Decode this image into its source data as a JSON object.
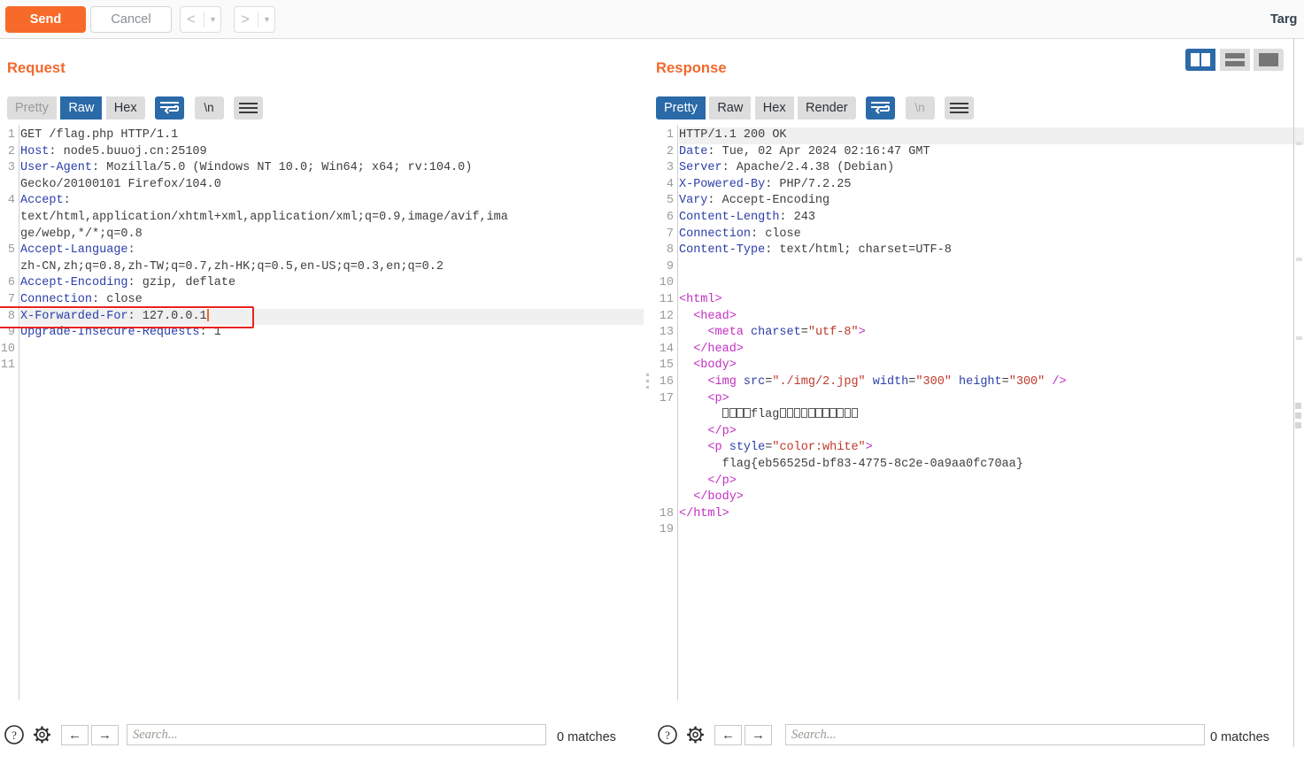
{
  "toolbar": {
    "send_label": "Send",
    "cancel_label": "Cancel",
    "prev_glyph": "<",
    "next_glyph": ">",
    "caret_glyph": "▼",
    "target_label": "Targ",
    "accent_color": "#f76a29"
  },
  "layout_buttons": {
    "side_by_side": "side-by-side",
    "stacked": "stacked",
    "single": "single-pane",
    "selected": "side-by-side"
  },
  "request": {
    "title": "Request",
    "tabs": [
      {
        "label": "Pretty",
        "state": "disabled"
      },
      {
        "label": "Raw",
        "state": "selected"
      },
      {
        "label": "Hex",
        "state": "normal"
      }
    ],
    "wrap_button": {
      "icon": "word-wrap-icon",
      "state": "selected"
    },
    "newline_button": {
      "label": "\\n",
      "state": "normal"
    },
    "menu_button": {
      "icon": "hamburger-menu-icon"
    },
    "line_numbers": [
      "1",
      "2",
      "3",
      "",
      "4",
      "",
      "",
      "5",
      "",
      "6",
      "7",
      "8",
      "9",
      "10",
      "11"
    ],
    "lines": [
      {
        "n": "1",
        "segments": [
          {
            "t": "GET /flag.php HTTP/1.1",
            "c": "txt"
          }
        ]
      },
      {
        "n": "2",
        "segments": [
          {
            "t": "Host",
            "c": "hdr"
          },
          {
            "t": ": node5.buuoj.cn:25109",
            "c": "txt"
          }
        ]
      },
      {
        "n": "3",
        "segments": [
          {
            "t": "User-Agent",
            "c": "hdr"
          },
          {
            "t": ": Mozilla/5.0 (Windows NT 10.0; Win64; x64; rv:104.0)",
            "c": "txt"
          }
        ]
      },
      {
        "n": "",
        "segments": [
          {
            "t": "Gecko/20100101 Firefox/104.0",
            "c": "txt"
          }
        ]
      },
      {
        "n": "4",
        "segments": [
          {
            "t": "Accept",
            "c": "hdr"
          },
          {
            "t": ":",
            "c": "txt"
          }
        ]
      },
      {
        "n": "",
        "segments": [
          {
            "t": "text/html,application/xhtml+xml,application/xml;q=0.9,image/avif,ima",
            "c": "txt"
          }
        ]
      },
      {
        "n": "",
        "segments": [
          {
            "t": "ge/webp,*/*;q=0.8",
            "c": "txt"
          }
        ]
      },
      {
        "n": "5",
        "segments": [
          {
            "t": "Accept-Language",
            "c": "hdr"
          },
          {
            "t": ":",
            "c": "txt"
          }
        ]
      },
      {
        "n": "",
        "segments": [
          {
            "t": "zh-CN,zh;q=0.8,zh-TW;q=0.7,zh-HK;q=0.5,en-US;q=0.3,en;q=0.2",
            "c": "txt"
          }
        ]
      },
      {
        "n": "6",
        "segments": [
          {
            "t": "Accept-Encoding",
            "c": "hdr"
          },
          {
            "t": ": gzip, deflate",
            "c": "txt"
          }
        ]
      },
      {
        "n": "7",
        "segments": [
          {
            "t": "Connection",
            "c": "hdr"
          },
          {
            "t": ": close",
            "c": "txt"
          }
        ]
      },
      {
        "n": "8",
        "highlight": true,
        "caret": true,
        "segments": [
          {
            "t": "X-Forwarded-For",
            "c": "hdr"
          },
          {
            "t": ": 127.0.0.1",
            "c": "txt"
          }
        ]
      },
      {
        "n": "9",
        "segments": [
          {
            "t": "Upgrade-Insecure-Requests",
            "c": "hdr"
          },
          {
            "t": ": 1",
            "c": "txt"
          }
        ]
      },
      {
        "n": "10",
        "segments": []
      },
      {
        "n": "11",
        "segments": []
      }
    ],
    "annotation": {
      "shape": "rectangle",
      "color": "#e8231f",
      "targets_line": "8"
    },
    "search": {
      "help_icon": "help-circle-icon",
      "settings_icon": "gear-icon",
      "prev_icon": "arrow-left-icon",
      "next_icon": "arrow-right-icon",
      "placeholder": "Search...",
      "value": "",
      "matches": "0 matches"
    }
  },
  "response": {
    "title": "Response",
    "tabs": [
      {
        "label": "Pretty",
        "state": "selected"
      },
      {
        "label": "Raw",
        "state": "normal"
      },
      {
        "label": "Hex",
        "state": "normal"
      },
      {
        "label": "Render",
        "state": "normal"
      }
    ],
    "wrap_button": {
      "icon": "word-wrap-icon",
      "state": "selected"
    },
    "newline_button": {
      "label": "\\n",
      "state": "disabled"
    },
    "menu_button": {
      "icon": "hamburger-menu-icon"
    },
    "lines": [
      {
        "n": "1",
        "highlight": true,
        "segments": [
          {
            "t": "HTTP/1.1 200 OK",
            "c": "txt"
          }
        ]
      },
      {
        "n": "2",
        "segments": [
          {
            "t": "Date",
            "c": "hdr"
          },
          {
            "t": ": Tue, 02 Apr 2024 02:16:47 GMT",
            "c": "txt"
          }
        ]
      },
      {
        "n": "3",
        "segments": [
          {
            "t": "Server",
            "c": "hdr"
          },
          {
            "t": ": Apache/2.4.38 (Debian)",
            "c": "txt"
          }
        ]
      },
      {
        "n": "4",
        "segments": [
          {
            "t": "X-Powered-By",
            "c": "hdr"
          },
          {
            "t": ": PHP/7.2.25",
            "c": "txt"
          }
        ]
      },
      {
        "n": "5",
        "segments": [
          {
            "t": "Vary",
            "c": "hdr"
          },
          {
            "t": ": Accept-Encoding",
            "c": "txt"
          }
        ]
      },
      {
        "n": "6",
        "segments": [
          {
            "t": "Content-Length",
            "c": "hdr"
          },
          {
            "t": ": 243",
            "c": "txt"
          }
        ]
      },
      {
        "n": "7",
        "segments": [
          {
            "t": "Connection",
            "c": "hdr"
          },
          {
            "t": ": close",
            "c": "txt"
          }
        ]
      },
      {
        "n": "8",
        "segments": [
          {
            "t": "Content-Type",
            "c": "hdr"
          },
          {
            "t": ": text/html; charset=UTF-8",
            "c": "txt"
          }
        ]
      },
      {
        "n": "9",
        "segments": []
      },
      {
        "n": "10",
        "segments": []
      },
      {
        "n": "11",
        "segments": [
          {
            "t": "<html>",
            "c": "tag"
          }
        ]
      },
      {
        "n": "12",
        "segments": [
          {
            "t": "  ",
            "c": "txt"
          },
          {
            "t": "<head>",
            "c": "tag"
          }
        ]
      },
      {
        "n": "13",
        "segments": [
          {
            "t": "    ",
            "c": "txt"
          },
          {
            "t": "<meta ",
            "c": "tag"
          },
          {
            "t": "charset",
            "c": "att"
          },
          {
            "t": "=",
            "c": "txt"
          },
          {
            "t": "\"utf-8\"",
            "c": "val"
          },
          {
            "t": ">",
            "c": "tag"
          }
        ]
      },
      {
        "n": "14",
        "segments": [
          {
            "t": "  ",
            "c": "txt"
          },
          {
            "t": "</head>",
            "c": "tag"
          }
        ]
      },
      {
        "n": "15",
        "segments": [
          {
            "t": "  ",
            "c": "txt"
          },
          {
            "t": "<body>",
            "c": "tag"
          }
        ]
      },
      {
        "n": "16",
        "segments": [
          {
            "t": "    ",
            "c": "txt"
          },
          {
            "t": "<img ",
            "c": "tag"
          },
          {
            "t": "src",
            "c": "att"
          },
          {
            "t": "=",
            "c": "txt"
          },
          {
            "t": "\"./img/2.jpg\"",
            "c": "val"
          },
          {
            "t": " ",
            "c": "txt"
          },
          {
            "t": "width",
            "c": "att"
          },
          {
            "t": "=",
            "c": "txt"
          },
          {
            "t": "\"300\"",
            "c": "val"
          },
          {
            "t": " ",
            "c": "txt"
          },
          {
            "t": "height",
            "c": "att"
          },
          {
            "t": "=",
            "c": "txt"
          },
          {
            "t": "\"300\"",
            "c": "val"
          },
          {
            "t": " />",
            "c": "tag"
          }
        ]
      },
      {
        "n": "17",
        "segments": [
          {
            "t": "    ",
            "c": "txt"
          },
          {
            "t": "<p>",
            "c": "tag"
          }
        ]
      },
      {
        "n": "",
        "tofu_line": true,
        "tofu_before": 4,
        "tofu_text": "flag",
        "tofu_after": 11,
        "indent": "      ",
        "segments": []
      },
      {
        "n": "",
        "segments": [
          {
            "t": "    ",
            "c": "txt"
          },
          {
            "t": "</p>",
            "c": "tag"
          }
        ]
      },
      {
        "n": "",
        "segments": [
          {
            "t": "    ",
            "c": "txt"
          },
          {
            "t": "<p ",
            "c": "tag"
          },
          {
            "t": "style",
            "c": "att"
          },
          {
            "t": "=",
            "c": "txt"
          },
          {
            "t": "\"color:white\"",
            "c": "val"
          },
          {
            "t": ">",
            "c": "tag"
          }
        ]
      },
      {
        "n": "",
        "segments": [
          {
            "t": "      flag{eb56525d-bf83-4775-8c2e-0a9aa0fc70aa}",
            "c": "txt"
          }
        ]
      },
      {
        "n": "",
        "segments": [
          {
            "t": "    ",
            "c": "txt"
          },
          {
            "t": "</p>",
            "c": "tag"
          }
        ]
      },
      {
        "n": "",
        "segments": [
          {
            "t": "  ",
            "c": "txt"
          },
          {
            "t": "</body>",
            "c": "tag"
          }
        ]
      },
      {
        "n": "18",
        "segments": [
          {
            "t": "</html>",
            "c": "tag"
          }
        ]
      },
      {
        "n": "19",
        "segments": []
      }
    ],
    "search": {
      "help_icon": "help-circle-icon",
      "settings_icon": "gear-icon",
      "prev_icon": "arrow-left-icon",
      "next_icon": "arrow-right-icon",
      "placeholder": "Search...",
      "value": "",
      "matches": "0 matches"
    }
  }
}
